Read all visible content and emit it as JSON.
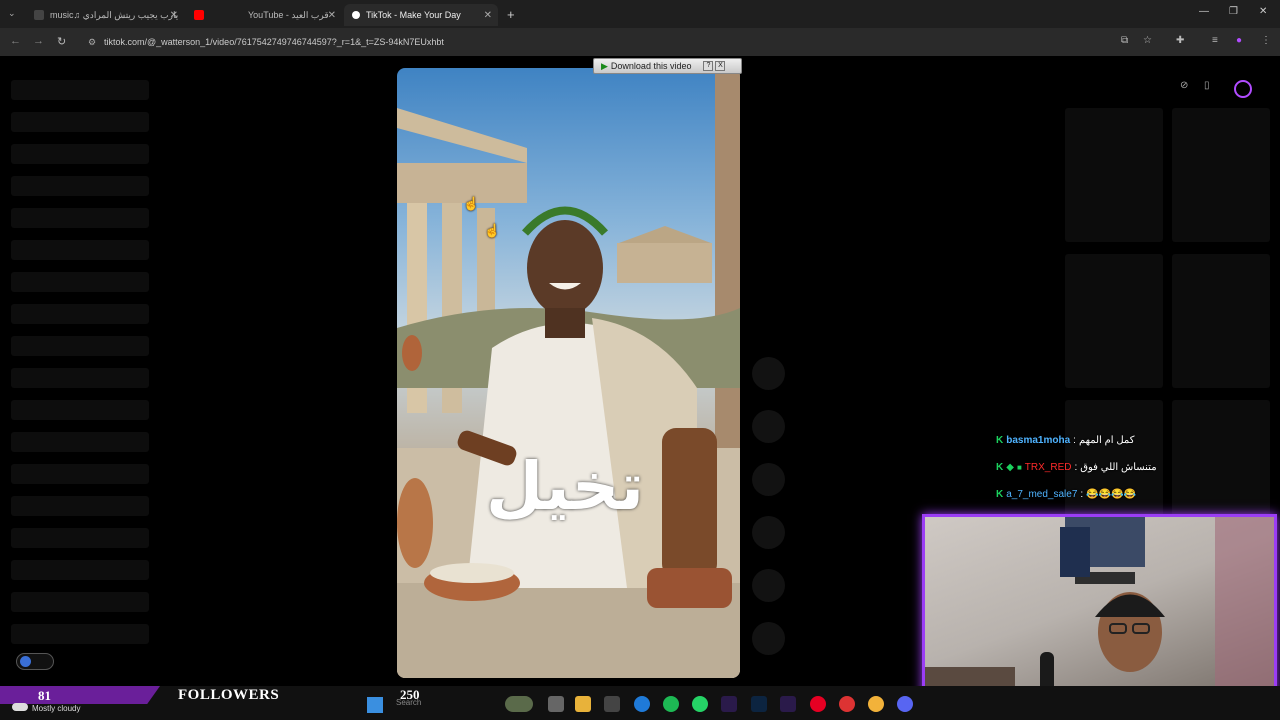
{
  "browser": {
    "tabs": [
      {
        "label": "music♫ يارب يجيب ريتش المرادي",
        "active": false,
        "color": "#e53935"
      },
      {
        "label": "YouTube - قرب العيد",
        "active": false,
        "color": "#ff0000"
      },
      {
        "label": "TikTok - Make Your Day",
        "active": true,
        "color": "#111111"
      }
    ],
    "new_tab": "+",
    "url": "tiktok.com/@_watterson_1/video/7617542749746744597?_r=1&_t=ZS-94kN7EUxhbt"
  },
  "downloader": {
    "label": "Download this video",
    "help": "?",
    "close": "X"
  },
  "video": {
    "overlay_text": "تخيل"
  },
  "chat": [
    {
      "badge": "K",
      "user": "basma1moha",
      "user_color": "#4fb3ff",
      "message": "كمل ام المهم",
      "message_color": "#ffffff"
    },
    {
      "badge": "K",
      "user": "TRX_RED",
      "user_color": "#ff2b2b",
      "message": "متنساش اللي فوق",
      "message_color": "#ffffff"
    },
    {
      "badge": "K",
      "user": "a_7_med_sale7",
      "user_color": "#4fb3ff",
      "message": "😂😂😂😂",
      "message_color": "#ffd84a"
    }
  ],
  "followers": {
    "count": "81",
    "label": "FOLLOWERS",
    "goal": "250"
  },
  "taskbar": {
    "weather": "Mostly cloudy",
    "search_placeholder": "Search"
  },
  "colors": {
    "webcam_border": "#9b3df5",
    "followers_pill": "#6a1f9a"
  }
}
